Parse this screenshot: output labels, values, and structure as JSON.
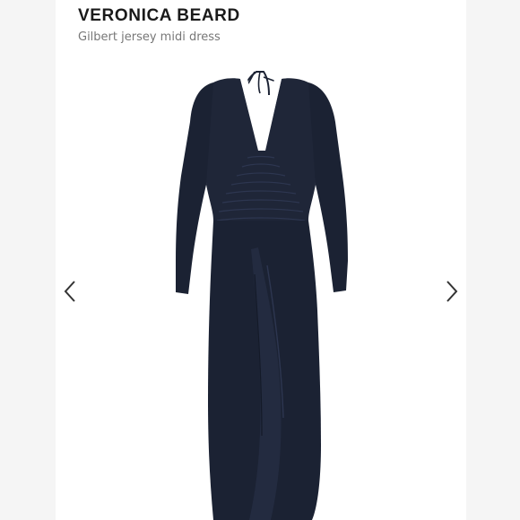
{
  "header": {
    "brand": "VERONICA BEARD",
    "product_name": "Gilbert jersey midi dress"
  },
  "gallery": {
    "prev_icon": "chevron-left-icon",
    "next_icon": "chevron-right-icon",
    "image_subject": "navy long-sleeve ruched jersey midi dress with halter tie"
  },
  "colors": {
    "dress": "#1b2233",
    "background": "#f5f5f5",
    "panel": "#ffffff",
    "brand_text": "#1a1a1a",
    "subtitle_text": "#777777"
  }
}
